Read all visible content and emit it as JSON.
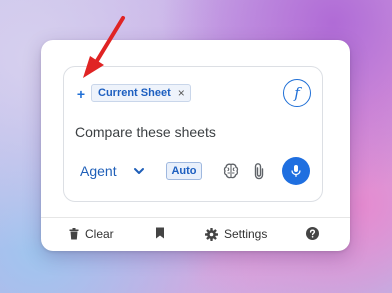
{
  "composer": {
    "add_context_label": "+",
    "context_chip_label": "Current Sheet",
    "context_chip_remove": "×",
    "formula_icon_glyph": "f",
    "prompt_text": "Compare these sheets",
    "mode_label": "Agent",
    "auto_label": "Auto"
  },
  "footer": {
    "clear_label": "Clear",
    "settings_label": "Settings"
  },
  "colors": {
    "accent": "#1f6fd6",
    "mic_button": "#1f6fe0",
    "annotation_arrow": "#e02424"
  },
  "icons": [
    "plus-icon",
    "close-icon",
    "function-icon",
    "chevron-down-icon",
    "brain-icon",
    "paperclip-icon",
    "microphone-icon",
    "trash-icon",
    "bookmark-icon",
    "gear-icon",
    "help-icon",
    "annotation-arrow"
  ]
}
